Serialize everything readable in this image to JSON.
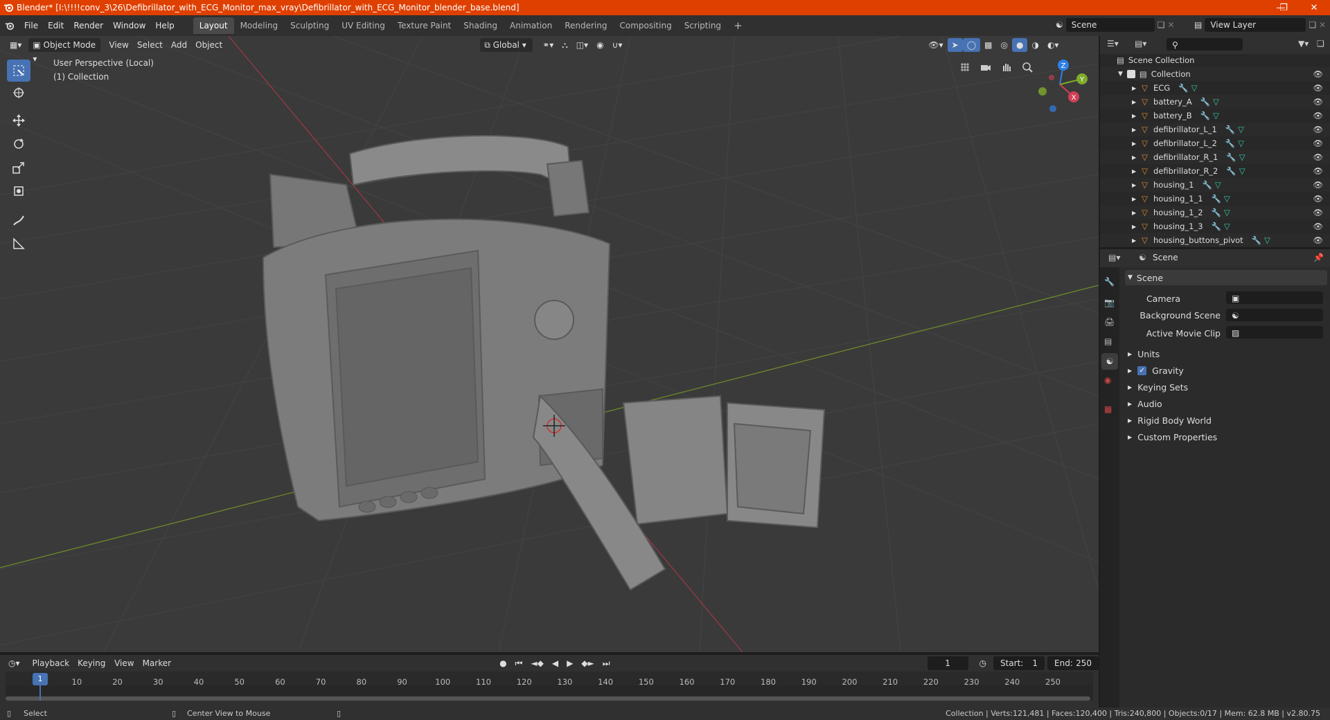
{
  "window": {
    "title": "Blender* [I:\\!!!!conv_3\\26\\Defibrillator_with_ECG_Monitor_max_vray\\Defibrillator_with_ECG_Monitor_blender_base.blend]"
  },
  "menu": [
    "File",
    "Edit",
    "Render",
    "Window",
    "Help"
  ],
  "workspaces": [
    "Layout",
    "Modeling",
    "Sculpting",
    "UV Editing",
    "Texture Paint",
    "Shading",
    "Animation",
    "Rendering",
    "Compositing",
    "Scripting"
  ],
  "active_workspace": "Layout",
  "scene_field": "Scene",
  "viewlayer_field": "View Layer",
  "viewport": {
    "mode": "Object Mode",
    "menus": [
      "View",
      "Select",
      "Add",
      "Object"
    ],
    "transform": "Global",
    "overlay_title": "User Perspective (Local)",
    "overlay_collection": "(1) Collection",
    "gizmo_axes": {
      "x": "X",
      "y": "Y",
      "z": "Z"
    }
  },
  "outliner": {
    "root": "Scene Collection",
    "collection": "Collection",
    "items": [
      "ECG",
      "battery_A",
      "battery_B",
      "defibrillator_L_1",
      "defibrillator_L_2",
      "defibrillator_R_1",
      "defibrillator_R_2",
      "housing_1",
      "housing_1_1",
      "housing_1_2",
      "housing_1_3",
      "housing_buttons_pivot"
    ]
  },
  "properties": {
    "header": "Scene",
    "panel": "Scene",
    "camera_label": "Camera",
    "background_label": "Background Scene",
    "movieclip_label": "Active Movie Clip",
    "sections": [
      "Units",
      "Gravity",
      "Keying Sets",
      "Audio",
      "Rigid Body World",
      "Custom Properties"
    ],
    "gravity_checked": true
  },
  "timeline": {
    "menus": [
      "Playback",
      "Keying",
      "View",
      "Marker"
    ],
    "current_frame": "1",
    "start_label": "Start:",
    "start": "1",
    "end_label": "End:",
    "end": "250",
    "ticks": [
      "1",
      "10",
      "20",
      "30",
      "40",
      "50",
      "60",
      "70",
      "80",
      "90",
      "100",
      "110",
      "120",
      "130",
      "140",
      "150",
      "160",
      "170",
      "180",
      "190",
      "200",
      "210",
      "220",
      "230",
      "240",
      "250"
    ]
  },
  "status": {
    "left": "Select",
    "mid": "Center View to Mouse",
    "right": "Collection | Verts:121,481 | Faces:120,400 | Tris:240,800 | Objects:0/17 | Mem: 62.8 MB | v2.80.75"
  },
  "colors": {
    "title_bar": "#df4000",
    "accent": "#4772b3",
    "object_icon": "#e08a30",
    "mesh_icon": "#35c9a6",
    "axis_x": "#d14055",
    "axis_y": "#7fab2a",
    "axis_z": "#2f7fe6"
  }
}
